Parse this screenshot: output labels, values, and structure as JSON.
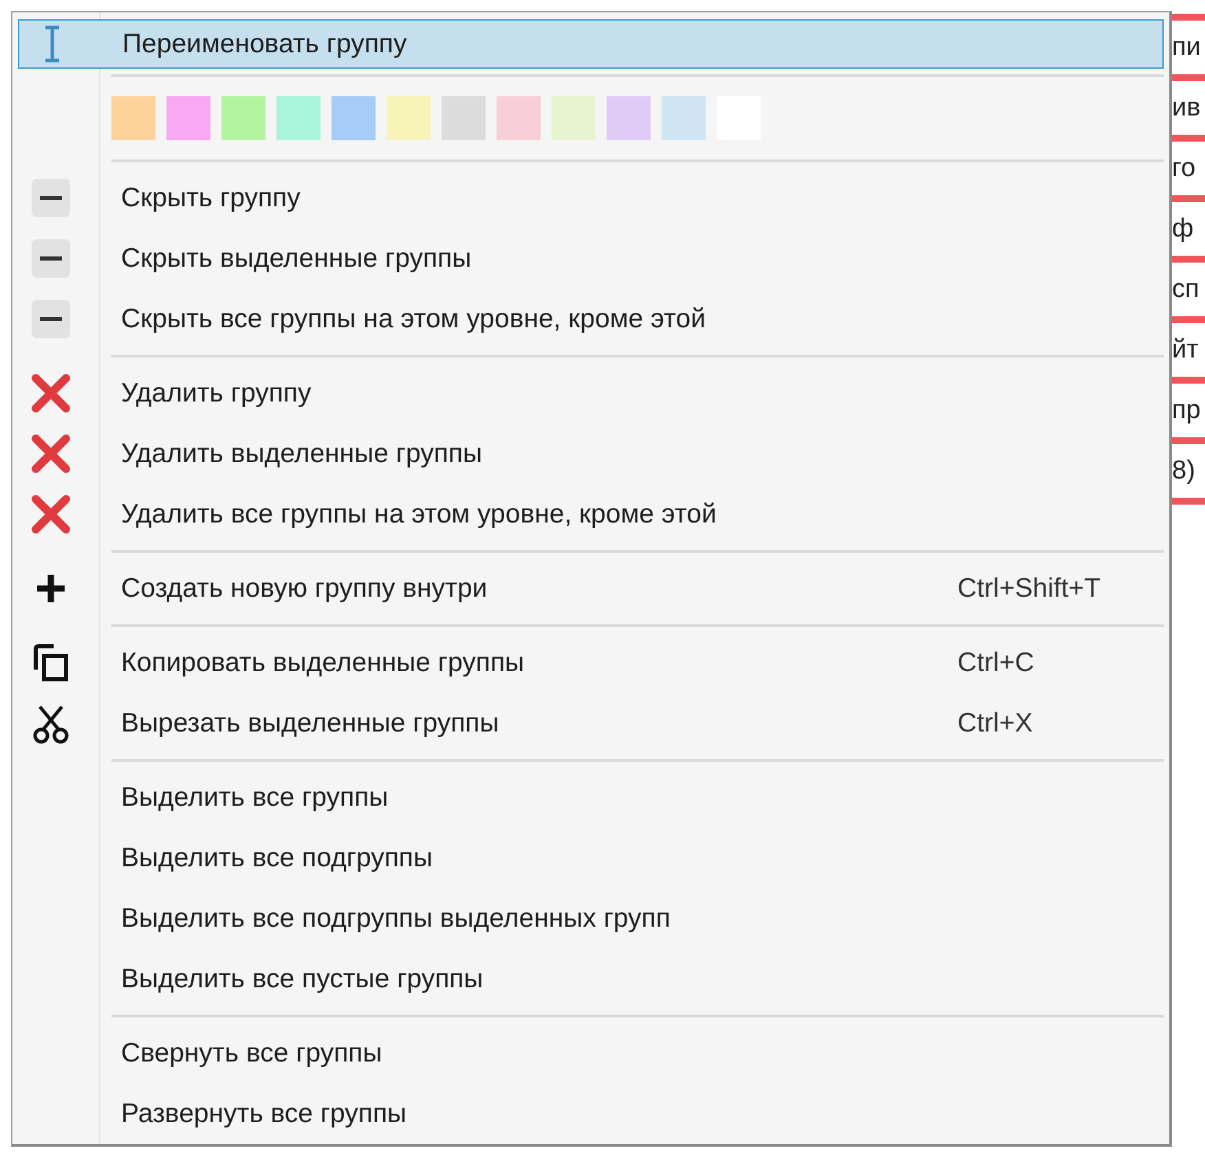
{
  "background": {
    "fragments": [
      {
        "text": "пи"
      },
      {
        "text": "ив"
      },
      {
        "text": "го"
      },
      {
        "text": "ф"
      },
      {
        "text": "сп"
      },
      {
        "text": "йт"
      },
      {
        "text": "пр"
      },
      {
        "text": "8)"
      }
    ]
  },
  "menu": {
    "groups": [
      {
        "items": [
          {
            "kind": "rename",
            "label": "Переименовать группу",
            "selected": true
          }
        ]
      },
      {
        "items": [
          {
            "kind": "swatches",
            "swatches": [
              {
                "color": "#fdd39b"
              },
              {
                "color": "#f9a8f3"
              },
              {
                "color": "#b3f59e"
              },
              {
                "color": "#a8f5dc"
              },
              {
                "color": "#a6cdf8"
              },
              {
                "color": "#f8f4b8"
              },
              {
                "color": "#dcdcdc"
              },
              {
                "color": "#f8cfd8"
              },
              {
                "color": "#e6f5d0"
              },
              {
                "color": "#dfcbf5"
              },
              {
                "color": "#cfe5f3"
              },
              {
                "color": "#ffffff"
              }
            ]
          }
        ]
      },
      {
        "items": [
          {
            "kind": "hide",
            "label": "Скрыть группу",
            "selected": false
          },
          {
            "kind": "hide",
            "label": "Скрыть выделенные группы",
            "selected": false
          },
          {
            "kind": "hide",
            "label": "Скрыть все группы на этом уровне, кроме этой",
            "selected": false
          }
        ]
      },
      {
        "items": [
          {
            "kind": "delete",
            "label": "Удалить группу",
            "selected": false
          },
          {
            "kind": "delete",
            "label": "Удалить выделенные группы",
            "selected": false
          },
          {
            "kind": "delete",
            "label": "Удалить все группы на этом уровне, кроме этой",
            "selected": false
          }
        ]
      },
      {
        "items": [
          {
            "kind": "create",
            "label": "Создать новую группу внутри",
            "shortcut": "Ctrl+Shift+T",
            "selected": false
          }
        ]
      },
      {
        "items": [
          {
            "kind": "copy",
            "label": "Копировать выделенные группы",
            "shortcut": "Ctrl+C",
            "selected": false
          },
          {
            "kind": "cut",
            "label": "Вырезать выделенные группы",
            "shortcut": "Ctrl+X",
            "selected": false
          }
        ]
      },
      {
        "items": [
          {
            "kind": "plain",
            "label": "Выделить все группы",
            "selected": false
          },
          {
            "kind": "plain",
            "label": "Выделить все подгруппы",
            "selected": false
          },
          {
            "kind": "plain",
            "label": "Выделить все подгруппы выделенных групп",
            "selected": false
          },
          {
            "kind": "plain",
            "label": "Выделить все пустые группы",
            "selected": false
          }
        ]
      },
      {
        "items": [
          {
            "kind": "plain",
            "label": "Свернуть все группы",
            "selected": false
          },
          {
            "kind": "plain",
            "label": "Развернуть все группы",
            "selected": false
          }
        ]
      }
    ]
  }
}
